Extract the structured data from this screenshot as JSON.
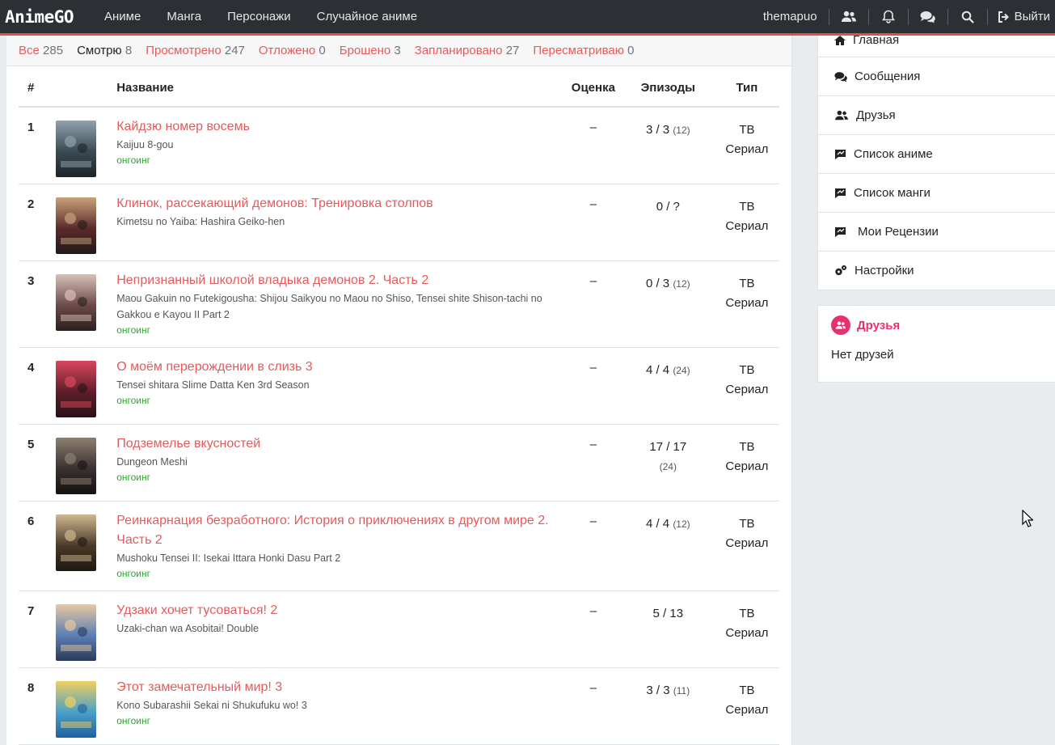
{
  "nav": {
    "brand": "AnimeGO",
    "links": [
      "Аниме",
      "Манга",
      "Персонажи",
      "Случайное аниме"
    ],
    "user": "themapuo",
    "logout": "Выйти"
  },
  "filters": [
    {
      "label": "Все",
      "count": "285"
    },
    {
      "label": "Смотрю",
      "count": "8"
    },
    {
      "label": "Просмотрено",
      "count": "247"
    },
    {
      "label": "Отложено",
      "count": "0"
    },
    {
      "label": "Брошено",
      "count": "3"
    },
    {
      "label": "Запланировано",
      "count": "27"
    },
    {
      "label": "Пересматриваю",
      "count": "0"
    }
  ],
  "table": {
    "headers": {
      "num": "#",
      "title": "Название",
      "score": "Оценка",
      "episodes": "Эпизоды",
      "type": "Тип"
    },
    "rows": [
      {
        "num": "1",
        "title": "Кайдзю номер восемь",
        "orig": "Kaijuu 8-gou",
        "status": "онгоинг",
        "score": "–",
        "eps": "3 / 3",
        "total": "(12)",
        "type1": "ТВ",
        "type2": "Сериал"
      },
      {
        "num": "2",
        "title": "Клинок, рассекающий демонов: Тренировка столпов",
        "orig": "Kimetsu no Yaiba: Hashira Geiko-hen",
        "status": "",
        "score": "–",
        "eps": "0 / ?",
        "total": "",
        "type1": "ТВ",
        "type2": "Сериал"
      },
      {
        "num": "3",
        "title": "Непризнанный школой владыка демонов 2. Часть 2",
        "orig": "Maou Gakuin no Futekigousha: Shijou Saikyou no Maou no Shiso, Tensei shite Shison-tachi no Gakkou e Kayou II Part 2",
        "status": "онгоинг",
        "score": "–",
        "eps": "0 / 3",
        "total": "(12)",
        "type1": "ТВ",
        "type2": "Сериал"
      },
      {
        "num": "4",
        "title": "О моём перерождении в слизь 3",
        "orig": "Tensei shitara Slime Datta Ken 3rd Season",
        "status": "онгоинг",
        "score": "–",
        "eps": "4 / 4",
        "total": "(24)",
        "type1": "ТВ",
        "type2": "Сериал"
      },
      {
        "num": "5",
        "title": "Подземелье вкусностей",
        "orig": "Dungeon Meshi",
        "status": "онгоинг",
        "score": "–",
        "eps": "17 / 17",
        "total": "(24)",
        "type1": "ТВ",
        "type2": "Сериал"
      },
      {
        "num": "6",
        "title": "Реинкарнация безработного: История о приключениях в другом мире 2. Часть 2",
        "orig": "Mushoku Tensei II: Isekai Ittara Honki Dasu Part 2",
        "status": "онгоинг",
        "score": "–",
        "eps": "4 / 4",
        "total": "(12)",
        "type1": "ТВ",
        "type2": "Сериал"
      },
      {
        "num": "7",
        "title": "Удзаки хочет тусоваться! 2",
        "orig": "Uzaki-chan wa Asobitai! Double",
        "status": "",
        "score": "–",
        "eps": "5 / 13",
        "total": "",
        "type1": "ТВ",
        "type2": "Сериал"
      },
      {
        "num": "8",
        "title": "Этот замечательный мир! 3",
        "orig": "Kono Subarashii Sekai ni Shukufuku wo! 3",
        "status": "онгоинг",
        "score": "–",
        "eps": "3 / 3",
        "total": "(11)",
        "type1": "ТВ",
        "type2": "Сериал"
      }
    ]
  },
  "sidebar": {
    "menu": [
      {
        "label": "Главная",
        "icon": "home-icon"
      },
      {
        "label": "Сообщения",
        "icon": "comments-icon"
      },
      {
        "label": "Друзья",
        "icon": "users-icon"
      },
      {
        "label": "Список аниме",
        "icon": "list-icon"
      },
      {
        "label": "Список манги",
        "icon": "list-icon"
      },
      {
        "label": "Мои Рецензии",
        "icon": "review-icon"
      },
      {
        "label": "Настройки",
        "icon": "gears-icon"
      }
    ],
    "friends": {
      "title": "Друзья",
      "empty": "Нет друзей"
    }
  },
  "colors": {
    "accent": "#e55a5a",
    "navbar": "#2c2f33",
    "ongoing": "#2ca52c",
    "friends": "#e8306c"
  }
}
